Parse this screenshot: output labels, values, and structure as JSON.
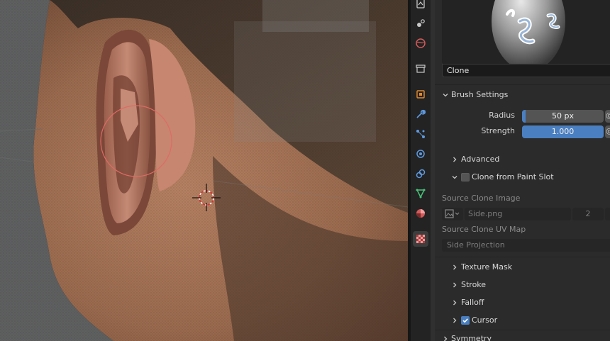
{
  "brush": {
    "name": "Clone"
  },
  "brush_settings": {
    "title": "Brush Settings",
    "radius_label": "Radius",
    "radius_value": "50 px",
    "radius_fraction": 0.04,
    "strength_label": "Strength",
    "strength_value": "1.000",
    "strength_fraction": 1.0,
    "lock_glyph": "@"
  },
  "subpanels": {
    "advanced": "Advanced",
    "clone_from_paint_slot": "Clone from Paint Slot",
    "clone_from_paint_slot_checked": false,
    "texture_mask": "Texture Mask",
    "stroke": "Stroke",
    "falloff": "Falloff",
    "cursor": "Cursor",
    "cursor_checked": true,
    "symmetry": "Symmetry"
  },
  "clone": {
    "source_image_label": "Source Clone Image",
    "source_image_value": "Side.png",
    "source_image_users": "2",
    "source_uv_label": "Source Clone UV Map",
    "source_uv_value": "Side Projection"
  },
  "tabs": [
    {
      "icon": "tool-icon"
    },
    {
      "icon": "render-icon"
    },
    {
      "icon": "output-icon"
    },
    {
      "icon": "view-layer-icon"
    },
    {
      "icon": "scene-icon"
    },
    {
      "icon": "world-icon"
    },
    {
      "icon": "collection-icon"
    },
    {
      "icon": "object-icon"
    },
    {
      "icon": "modifier-icon"
    },
    {
      "icon": "particles-icon"
    },
    {
      "icon": "physics-icon"
    },
    {
      "icon": "constraints-icon"
    },
    {
      "icon": "data-icon"
    },
    {
      "icon": "material-icon"
    },
    {
      "icon": "texture-icon"
    }
  ],
  "colors": {
    "accent": "#4a7fc1",
    "brush_circle": "#e06a64",
    "panel_bg": "#2b2b2b"
  }
}
